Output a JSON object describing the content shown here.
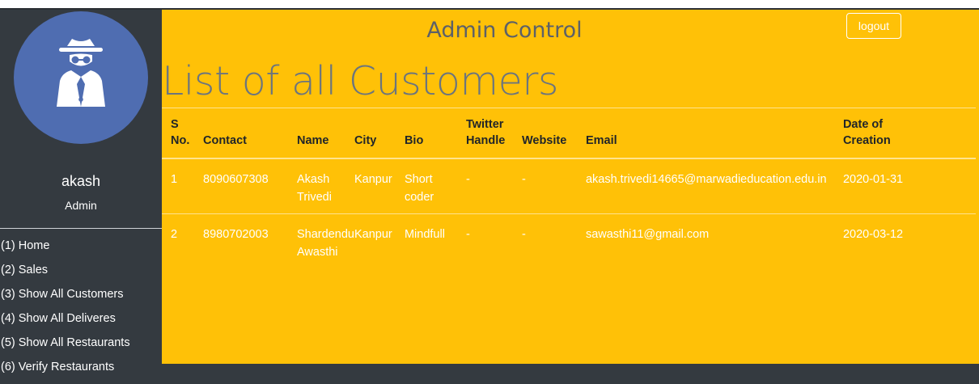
{
  "header": {
    "title": "Admin Control",
    "logout_label": "logout"
  },
  "page": {
    "title": "List of all Customers"
  },
  "profile": {
    "name": "akash",
    "role": "Admin"
  },
  "nav": [
    "(1) Home",
    "(2) Sales",
    "(3) Show All Customers",
    "(4) Show All Deliveres",
    "(5) Show All Restaurants",
    "(6) Verify Restaurants"
  ],
  "table": {
    "headers": {
      "sno_1": "S",
      "sno_2": "No.",
      "contact": "Contact",
      "name": "Name",
      "city": "City",
      "bio": "Bio",
      "twitter_1": "Twitter",
      "twitter_2": "Handle",
      "website": "Website",
      "email": "Email",
      "date_1": "Date of",
      "date_2": "Creation"
    },
    "rows": [
      {
        "sno": "1",
        "contact": "8090607308",
        "name_1": "Akash",
        "name_2": "Trivedi",
        "city": "Kanpur",
        "bio_1": "Short",
        "bio_2": "coder",
        "twitter": "-",
        "website": "-",
        "email": "akash.trivedi14665@marwadieducation.edu.in",
        "date": "2020-01-31"
      },
      {
        "sno": "2",
        "contact": "8980702003",
        "name_1": "Shardendu",
        "name_2": "Awasthi",
        "city": "Kanpur",
        "bio_1": "Mindfull",
        "bio_2": "",
        "twitter": "-",
        "website": "-",
        "email": "sawasthi11@gmail.com",
        "date": "2020-03-12"
      }
    ]
  },
  "colors": {
    "main_bg": "#ffc107",
    "sidebar_bg": "#343a40",
    "avatar_bg": "#4f6db1"
  },
  "icons": {
    "avatar": "incognito-agent-icon"
  }
}
